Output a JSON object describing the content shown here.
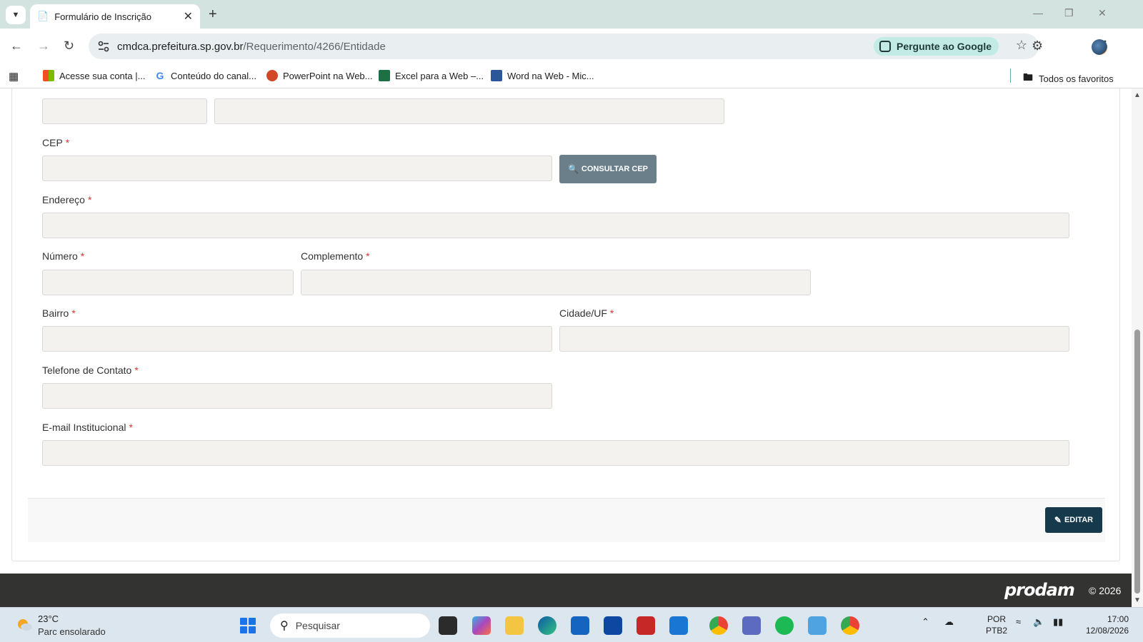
{
  "browser": {
    "tab_title": "Formulário de Inscrição",
    "url_host": "cmdca.prefeitura.sp.gov.br",
    "url_path": "/Requerimento/4266/Entidade",
    "ask_google": "Pergunte ao Google"
  },
  "bookmarks": [
    {
      "label": "Acesse sua conta |...",
      "icon": "microsoft-icon"
    },
    {
      "label": "Conteúdo do canal...",
      "icon": "google-icon"
    },
    {
      "label": "PowerPoint na Web...",
      "icon": "powerpoint-icon"
    },
    {
      "label": "Excel para a Web –...",
      "icon": "excel-icon"
    },
    {
      "label": "Word na Web - Mic...",
      "icon": "word-icon"
    }
  ],
  "all_bookmarks": "Todos os favoritos",
  "form": {
    "cep_label": "CEP",
    "consultar_cep": "CONSULTAR CEP",
    "endereco_label": "Endereço",
    "numero_label": "Número",
    "complemento_label": "Complemento",
    "bairro_label": "Bairro",
    "cidade_label": "Cidade/UF",
    "telefone_label": "Telefone de Contato",
    "email_label": "E-mail Institucional",
    "required_mark": "*",
    "editar": "EDITAR"
  },
  "footer": {
    "logo": "prodam",
    "copyright": "© 2026"
  },
  "taskbar": {
    "temp": "23°C",
    "weather": "Parc ensolarado",
    "search_placeholder": "Pesquisar",
    "lang_top": "POR",
    "lang_bottom": "PTB2",
    "time": "17:00",
    "date": "12/08/2026"
  },
  "colors": {
    "accent_dark": "#16394b",
    "button_gray": "#6a7f8a",
    "required_red": "#dd3333",
    "input_bg": "#f4f2ef",
    "footer_bg": "#333332"
  }
}
